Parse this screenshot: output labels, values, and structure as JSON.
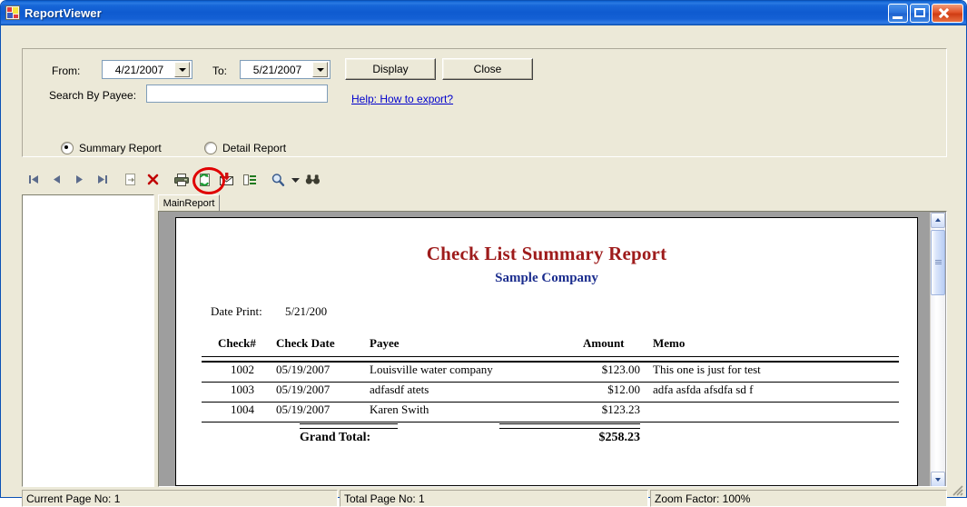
{
  "window": {
    "title": "ReportViewer",
    "icon": "report-viewer-icon",
    "buttons": {
      "minimize": "minimize-button",
      "maximize": "maximize-button",
      "close": "close-button"
    },
    "accent_title_blue": "#0f5bd0"
  },
  "criteria": {
    "from_label": "From:",
    "from_value": "4/21/2007",
    "to_label": "To:",
    "to_value": "5/21/2007",
    "search_label": "Search By Payee:",
    "search_value": "",
    "search_placeholder": "",
    "display_button": "Display",
    "close_button": "Close",
    "help_link": "Help: How to export?",
    "radios": [
      {
        "label": "Summary Report",
        "checked": true
      },
      {
        "label": "Detail Report",
        "checked": false
      }
    ]
  },
  "toolbar": {
    "buttons": [
      {
        "name": "first-page-icon",
        "title": "First Page"
      },
      {
        "name": "previous-page-icon",
        "title": "Previous Page"
      },
      {
        "name": "next-page-icon",
        "title": "Next Page"
      },
      {
        "name": "last-page-icon",
        "title": "Last Page"
      },
      {
        "name": "go-to-page-icon",
        "title": "Go To Page"
      },
      {
        "name": "stop-icon",
        "title": "Stop"
      },
      {
        "name": "print-icon",
        "title": "Print"
      },
      {
        "name": "refresh-icon",
        "title": "Refresh"
      },
      {
        "name": "export-icon",
        "title": "Export Report"
      },
      {
        "name": "toggle-group-tree-icon",
        "title": "Toggle Group Tree"
      },
      {
        "name": "zoom-icon",
        "title": "Zoom"
      },
      {
        "name": "zoom-dropdown-icon",
        "title": "Zoom Options"
      },
      {
        "name": "search-text-icon",
        "title": "Search Text"
      }
    ],
    "highlighted_button": "export-icon",
    "highlight_color": "#e00000"
  },
  "report_tab": {
    "label": "MainReport"
  },
  "report": {
    "title": "Check List Summary Report",
    "title_color": "#9e1b1b",
    "subtitle": "Sample Company",
    "subtitle_color": "#1b2d8e",
    "date_print_label": "Date Print:",
    "date_print_value": "5/21/200",
    "columns": [
      "Check#",
      "Check Date",
      "Payee",
      "Amount",
      "Memo"
    ],
    "rows": [
      {
        "check_no": "1002",
        "check_date": "05/19/2007",
        "payee": "Louisville water company",
        "amount": "$123.00",
        "memo": "This one is just for test"
      },
      {
        "check_no": "1003",
        "check_date": "05/19/2007",
        "payee": "adfasdf atets",
        "amount": "$12.00",
        "memo": "adfa asfda afsdfa sd f"
      },
      {
        "check_no": "1004",
        "check_date": "05/19/2007",
        "payee": "Karen Swith",
        "amount": "$123.23",
        "memo": ""
      }
    ],
    "grand_total_label": "Grand Total:",
    "grand_total_value": "$258.23"
  },
  "statusbar": {
    "current_page": "Current Page No: 1",
    "total_page": "Total Page No: 1",
    "zoom_factor": "Zoom Factor: 100%"
  }
}
